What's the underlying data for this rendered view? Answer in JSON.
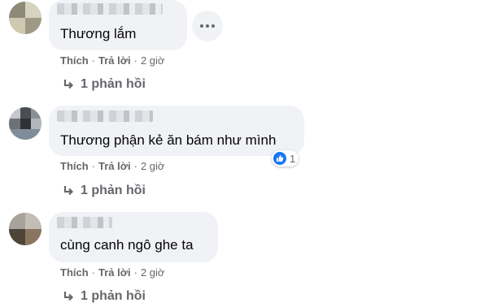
{
  "comments": [
    {
      "text": "Thương lắm",
      "like": "Thích",
      "reply": "Trả lời",
      "time": "2 giờ",
      "replies": "1 phản hồi"
    },
    {
      "text": "Thương phận kẻ ăn bám như mình",
      "like": "Thích",
      "reply": "Trả lời",
      "time": "2 giờ",
      "replies": "1 phản hồi",
      "reaction_count": "1"
    },
    {
      "text": "cùng canh ngô ghe ta",
      "like": "Thích",
      "reply": "Trả lời",
      "time": "2 giờ",
      "replies": "1 phản hồi"
    }
  ],
  "colors": {
    "bubble": "#f0f2f5",
    "meta": "#65676b",
    "text": "#050505",
    "like_blue": "#1877f2"
  },
  "icons": [
    "more-options-icon",
    "reply-arrow-icon",
    "like-reaction-icon"
  ]
}
